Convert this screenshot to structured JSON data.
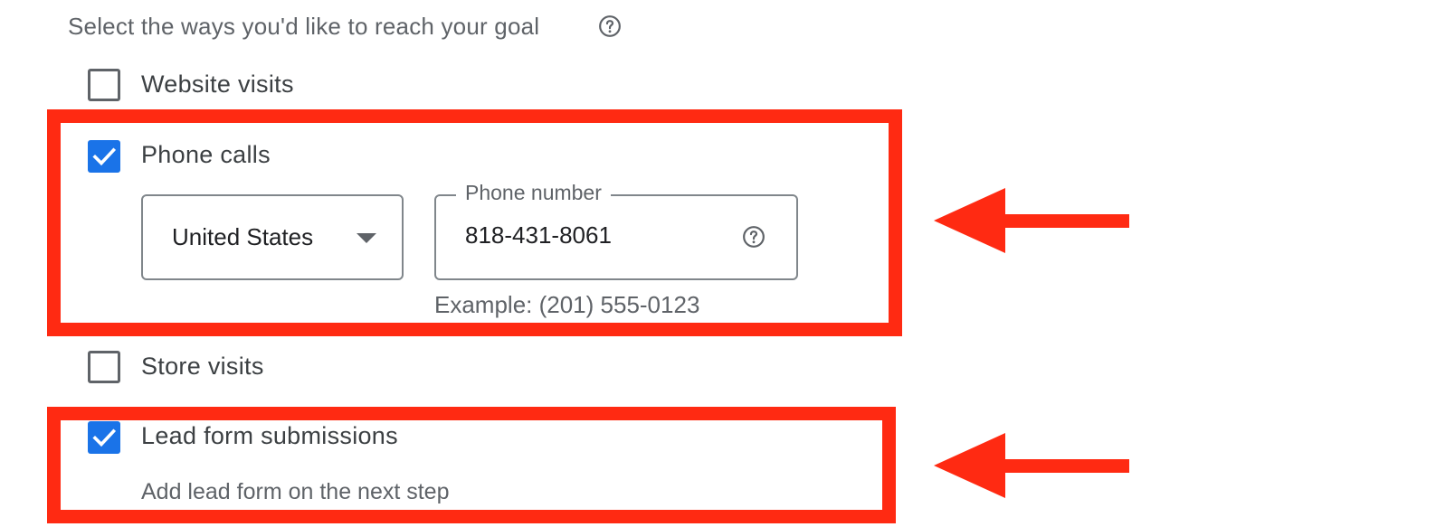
{
  "goal_section": {
    "heading": "Select the ways you'd like to reach your goal",
    "help_icon": "help-circle-icon"
  },
  "options": [
    {
      "label": "Website visits",
      "checked": false
    },
    {
      "label": "Phone calls",
      "checked": true
    },
    {
      "label": "Store visits",
      "checked": false
    },
    {
      "label": "Lead form submissions",
      "checked": true
    }
  ],
  "phone_calls": {
    "country_selected": "United States",
    "phone_label": "Phone number",
    "phone_value": "818-431-8061",
    "phone_example": "Example: (201) 555-0123"
  },
  "lead_form": {
    "sub_text": "Add lead form on the next step"
  },
  "annotations": {
    "highlight_color": "#ff2a12",
    "checkbox_color": "#1a73e8"
  }
}
